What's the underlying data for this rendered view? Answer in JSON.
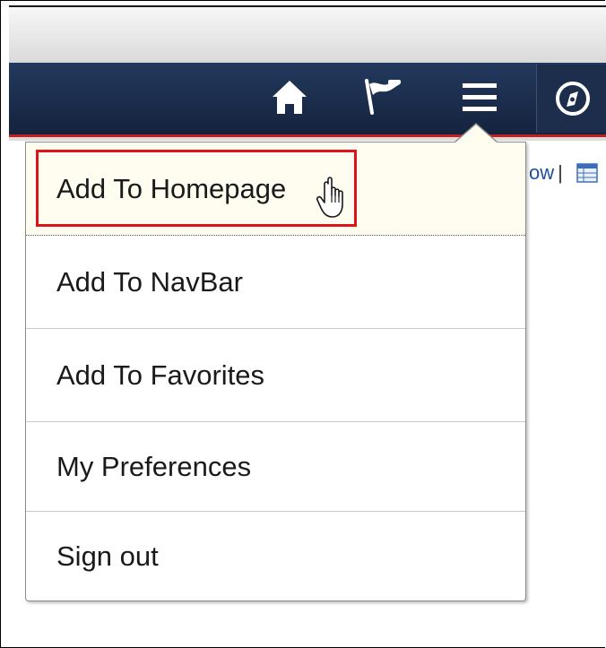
{
  "header": {
    "icons": [
      "home-icon",
      "flag-icon",
      "menu-icon",
      "navigator-icon"
    ],
    "colors": {
      "navbar": "#1b2b48",
      "accent_line": "#c41e1e"
    }
  },
  "page": {
    "behind_text": "ow",
    "behind_separator": "|"
  },
  "menu": {
    "items": [
      {
        "label": "Add To Homepage",
        "highlighted": true
      },
      {
        "label": "Add To NavBar"
      },
      {
        "label": "Add To Favorites"
      },
      {
        "label": "My Preferences"
      },
      {
        "label": "Sign out"
      }
    ],
    "highlight_color": "#e0121a",
    "hover_background": "#fefdf0"
  }
}
